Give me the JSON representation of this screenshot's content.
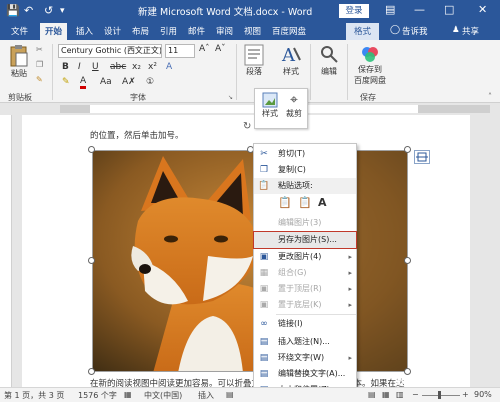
{
  "titlebar": {
    "title": "新建 Microsoft Word 文档.docx - Word",
    "login": "登录",
    "save_icon": "save-icon",
    "undo_icon": "undo-icon",
    "redo_icon": "redo-icon",
    "customize_icon": "customize-qat-icon"
  },
  "tabs": [
    "文件",
    "开始",
    "插入",
    "设计",
    "布局",
    "引用",
    "邮件",
    "审阅",
    "视图",
    "百度网盘",
    "格式"
  ],
  "tell_me": "告诉我",
  "share": "共享",
  "ribbon": {
    "clipboard": {
      "paste": "粘贴",
      "group": "剪贴板"
    },
    "font": {
      "name": "Century Gothic (西文正文)",
      "size": "11",
      "group": "字体",
      "bold": "B",
      "italic": "I",
      "underline": "U"
    },
    "paragraph": {
      "label": "段落"
    },
    "styles": {
      "label": "样式",
      "group": "样式"
    },
    "editing": {
      "label": "编辑"
    },
    "save": {
      "label1": "保存到",
      "label2": "百度网盘",
      "group": "保存"
    }
  },
  "mini_toolbar": {
    "style": "样式",
    "crop": "裁剪"
  },
  "document": {
    "line1": "的位置，然后单击加号。",
    "line2": "在新的阅读视图中阅读更加容易。可以折叠文档某些部分并关注所需文本。如果在达"
  },
  "context_menu": {
    "cut": "剪切(T)",
    "copy": "复制(C)",
    "paste_options": "粘贴选项:",
    "edit_picture": "编辑图片(3)",
    "save_as_picture": "另存为图片(S)...",
    "change_picture": "更改图片(4)",
    "group": "组合(G)",
    "bring_front": "置于顶层(R)",
    "send_back": "置于底层(K)",
    "link": "链接(I)",
    "insert_caption": "插入题注(N)...",
    "wrap_text": "环绕文字(W)",
    "edit_alt_text": "编辑替换文字(A)...",
    "size_position": "大小和位置(Z)..."
  },
  "status": {
    "page": "第 1 页，共 3 页",
    "words": "1576 个字",
    "language": "中文(中国)",
    "mode": "插入",
    "zoom": "90%"
  },
  "watermark": "Baidu 经验",
  "colors": {
    "word_blue": "#2b579a",
    "ribbon_bg": "#f3f3f3",
    "highlight_border": "#c0392b"
  }
}
